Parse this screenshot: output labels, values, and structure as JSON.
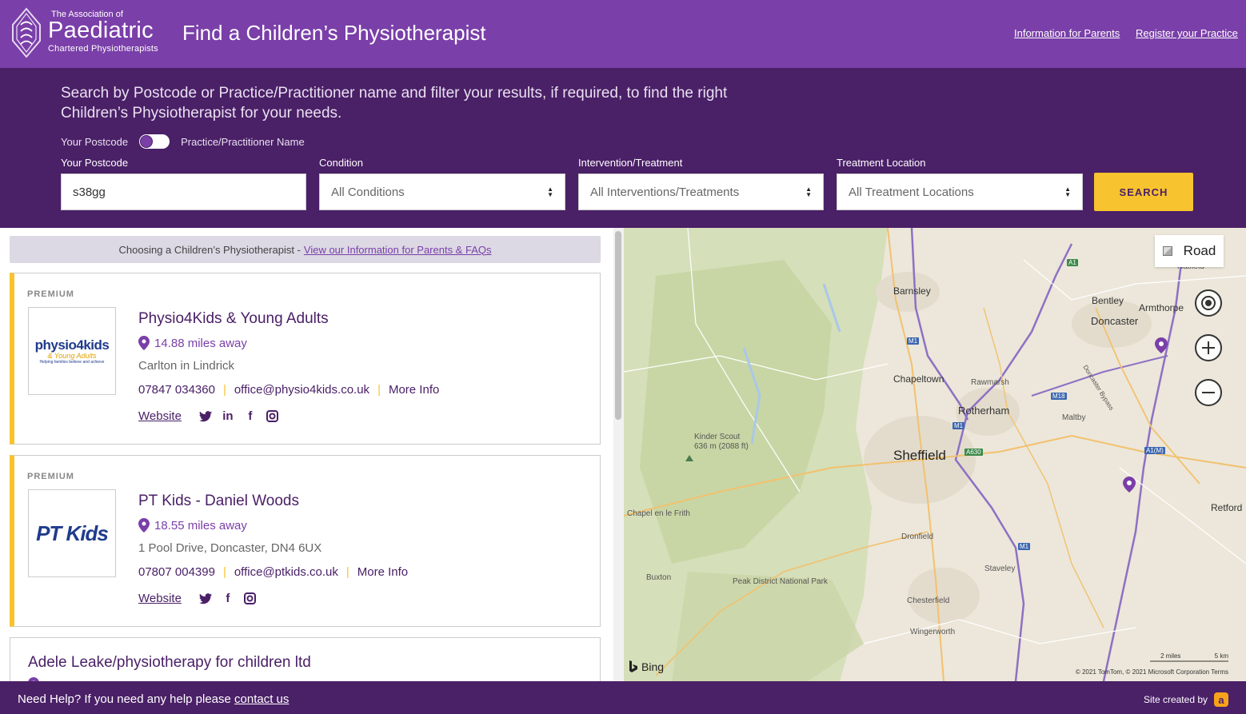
{
  "header": {
    "logo": {
      "line1": "The Association of",
      "line2": "Paediatric",
      "line3": "Chartered Physiotherapists"
    },
    "title": "Find a Children’s Physiotherapist",
    "links": {
      "parents": "Information for Parents",
      "register": "Register your Practice"
    },
    "brand_color": "#7a3fa8",
    "accent_color": "#f7c32e"
  },
  "search": {
    "intro": "Search by Postcode or Practice/Practitioner name and filter your results, if required, to find the right Children’s Physiotherapist for your needs.",
    "toggle_left": "Your Postcode",
    "toggle_right": "Practice/Practitioner Name",
    "postcode_label": "Your Postcode",
    "postcode_value": "s38gg",
    "condition_label": "Condition",
    "condition_value": "All Conditions",
    "intervention_label": "Intervention/Treatment",
    "intervention_value": "All Interventions/Treatments",
    "location_label": "Treatment Location",
    "location_value": "All Treatment Locations",
    "button": "SEARCH"
  },
  "notice": {
    "text": "Choosing a Children’s Physiotherapist -",
    "link": "View our Information for Parents & FAQs"
  },
  "results": [
    {
      "tier": "PREMIUM",
      "logo_text": "physio4kids",
      "logo_sub": "& Young Adults",
      "logo_tag": "Helping families believe and achieve",
      "name": "Physio4Kids & Young Adults",
      "distance": "14.88 miles away",
      "address": "Carlton in Lindrick",
      "phone": "07847 034360",
      "email": "office@physio4kids.co.uk",
      "more": "More Info",
      "website": "Website",
      "socials": [
        "twitter-icon",
        "linkedin-icon",
        "facebook-icon",
        "instagram-icon"
      ]
    },
    {
      "tier": "PREMIUM",
      "logo_text": "PT Kids",
      "name": "PT Kids - Daniel Woods",
      "distance": "18.55 miles away",
      "address": "1 Pool Drive, Doncaster, DN4 6UX",
      "phone": "07807 004399",
      "email": "office@ptkids.co.uk",
      "more": "More Info",
      "website": "Website",
      "socials": [
        "twitter-icon",
        "facebook-icon",
        "instagram-icon"
      ]
    },
    {
      "name": "Adele Leake/physiotherapy for children ltd"
    }
  ],
  "map": {
    "type_label": "Road",
    "labels": {
      "barnsley": "Barnsley",
      "bentley": "Bentley",
      "armthorpe": "Armthorpe",
      "doncaster": "Doncaster",
      "hatfield": "Hatfield",
      "chapeltown": "Chapeltown",
      "rawmarsh": "Rawmarsh",
      "rotherham": "Rotherham",
      "maltby": "Maltby",
      "kinder": "Kinder Scout",
      "kinder_height": "636 m (2088 ft)",
      "sheffield": "Sheffield",
      "chapel": "Chapel en le Frith",
      "retford": "Retford",
      "dronfield": "Dronfield",
      "staveley": "Staveley",
      "buxton": "Buxton",
      "peak": "Peak District National Park",
      "chesterfield": "Chesterfield",
      "wingerworth": "Wingerworth",
      "bypass": "Doncaster Bypass"
    },
    "roads": {
      "a1": "A1",
      "m1a": "M1",
      "m1b": "M1",
      "m1c": "M1",
      "m18": "M18",
      "a630": "A630",
      "a1m": "A1(M)"
    },
    "bing": "Bing",
    "scale_miles": "2 miles",
    "scale_km": "5 km",
    "copyright": "© 2021 TomTom, © 2021 Microsoft Corporation  Terms"
  },
  "footer": {
    "help_text": "Need Help? If you need any help please",
    "help_link": "contact us",
    "credit": "Site created by",
    "credit_mark": "a"
  }
}
